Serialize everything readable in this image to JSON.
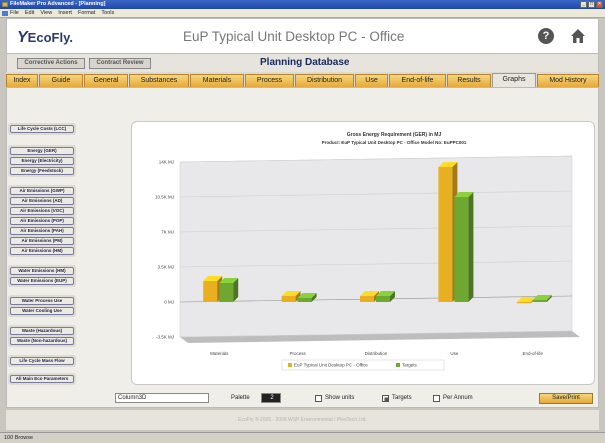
{
  "window": {
    "title": "FileMaker Pro Advanced - [Planning]",
    "menu": [
      "File",
      "Edit",
      "View",
      "Insert",
      "Format",
      "Tools"
    ]
  },
  "header": {
    "logo_text": "EcoFly.",
    "app_title": "EuP Typical Unit Desktop PC - Office",
    "help_label": "?"
  },
  "toprow": {
    "buttons": [
      "Corrective Actions",
      "Contract Review"
    ],
    "db_title": "Planning Database"
  },
  "tabs": [
    "Index",
    "Guide",
    "General",
    "Substances",
    "Materials",
    "Process",
    "Distribution",
    "Use",
    "End-of-life",
    "Results",
    "Graphs",
    "Mod History"
  ],
  "active_tab": "Graphs",
  "sidebar": {
    "groups": [
      [
        "Life Cycle Costs (LCC)"
      ],
      [
        "Energy (GER)",
        "Energy (Electricity)",
        "Energy (Feedstock)"
      ],
      [
        "Air Emissions (GWP)",
        "Air Emissions (AD)",
        "Air Emissions (VOC)",
        "Air Emissions (POP)",
        "Air Emissions (PAH)",
        "Air Emissions (PM)",
        "Air Emissions (HM)"
      ],
      [
        "Water Emissions (HM)",
        "Water Emissions (EUP)"
      ],
      [
        "Water Process Use",
        "Water Cooling Use"
      ],
      [
        "Waste (Hazardous)",
        "Waste (Non-hazardous)"
      ],
      [
        "Life Cycle Mass Flow"
      ],
      [
        "All Main Eco Parameters"
      ]
    ]
  },
  "chart_data": {
    "type": "bar",
    "title": "Gross Energy Requirement (GER) in MJ",
    "subtitle": "Product: EuP Typical Unit Desktop PC - Office  Model No: EuPPC001",
    "categories": [
      "Materials",
      "Process",
      "Distribution",
      "Use",
      "End-of-life"
    ],
    "series": [
      {
        "name": "EuP Typical Unit Desktop PC - Office",
        "color": "#e8b020",
        "values": [
          2.1,
          0.6,
          0.6,
          13.5,
          0.0
        ]
      },
      {
        "name": "Targets",
        "color": "#6ea830",
        "values": [
          1.9,
          0.4,
          0.6,
          10.5,
          0.2
        ]
      }
    ],
    "yticks": [
      "-3.5K MJ",
      "0 MJ",
      "3.5K MJ",
      "7K MJ",
      "10.5K MJ",
      "14K MJ"
    ],
    "ylim": [
      -3.5,
      14
    ],
    "legend_position": "bottom"
  },
  "controls": {
    "chart_type": "Column3D",
    "palette_label": "Palette",
    "palette_value": "2",
    "show_units": "Show units",
    "targets": "Targets",
    "per_annum": "Per Annum",
    "save_print": "Save/Print"
  },
  "footer": "EcoFly ® 2005 - 2008 WSP Environmental / PlesTech Ltd.",
  "status": "100  Browse"
}
